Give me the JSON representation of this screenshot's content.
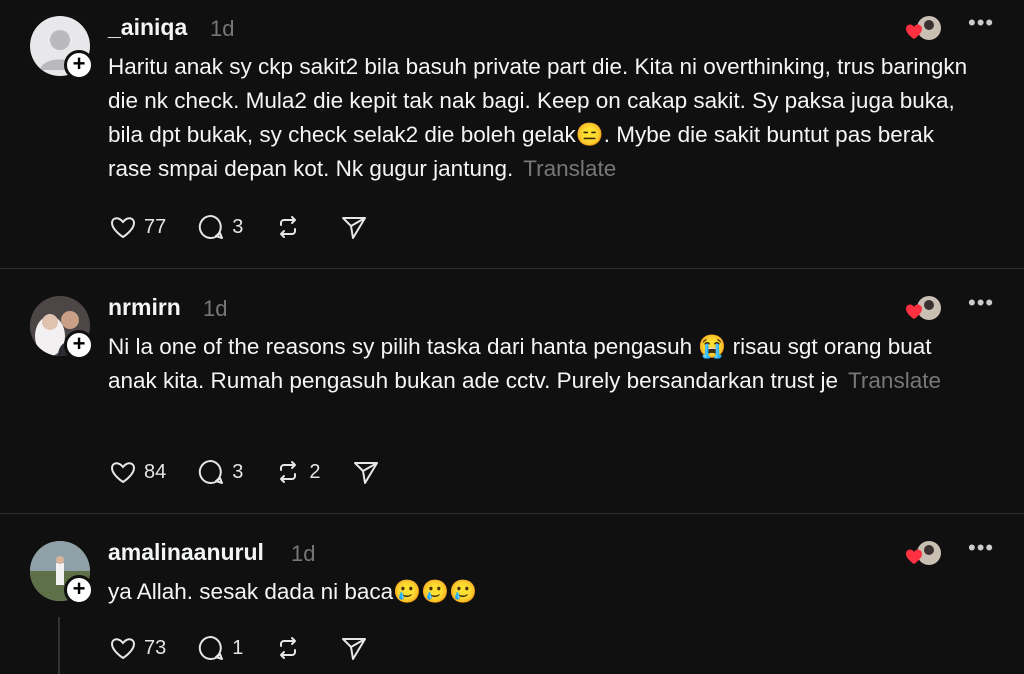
{
  "posts": [
    {
      "username": "_ainiqa",
      "time": "1d",
      "text": "Haritu anak sy ckp sakit2 bila basuh private part die. Kita ni overthinking, trus baringkn die nk check. Mula2 die kepit tak nak bagi. Keep on cakap sakit. Sy paksa juga buka, bila dpt bukak, sy check selak2 die boleh gelak😑. Mybe die sakit buntut pas berak rase smpai depan kot. Nk gugur jantung.",
      "translate": "Translate",
      "likes": "77",
      "replies": "3",
      "reposts": ""
    },
    {
      "username": "nrmirn",
      "time": "1d",
      "text": "Ni la one of the reasons sy pilih taska dari hanta pengasuh 😭 risau sgt orang buat anak kita. Rumah pengasuh bukan ade cctv. Purely bersandarkan trust je",
      "translate": "Translate",
      "likes": "84",
      "replies": "3",
      "reposts": "2"
    },
    {
      "username": "amalinaanurul",
      "time": "1d",
      "text": "ya Allah. sesak dada ni baca🥲🥲🥲",
      "translate": "",
      "likes": "73",
      "replies": "1",
      "reposts": ""
    }
  ],
  "colors": {
    "background": "#101010",
    "text": "#f3f5f7",
    "muted": "#777777",
    "heart": "#ff3040"
  },
  "icons": [
    "heart-icon",
    "comment-icon",
    "repost-icon",
    "share-icon",
    "more-icon",
    "follow-plus-icon"
  ]
}
